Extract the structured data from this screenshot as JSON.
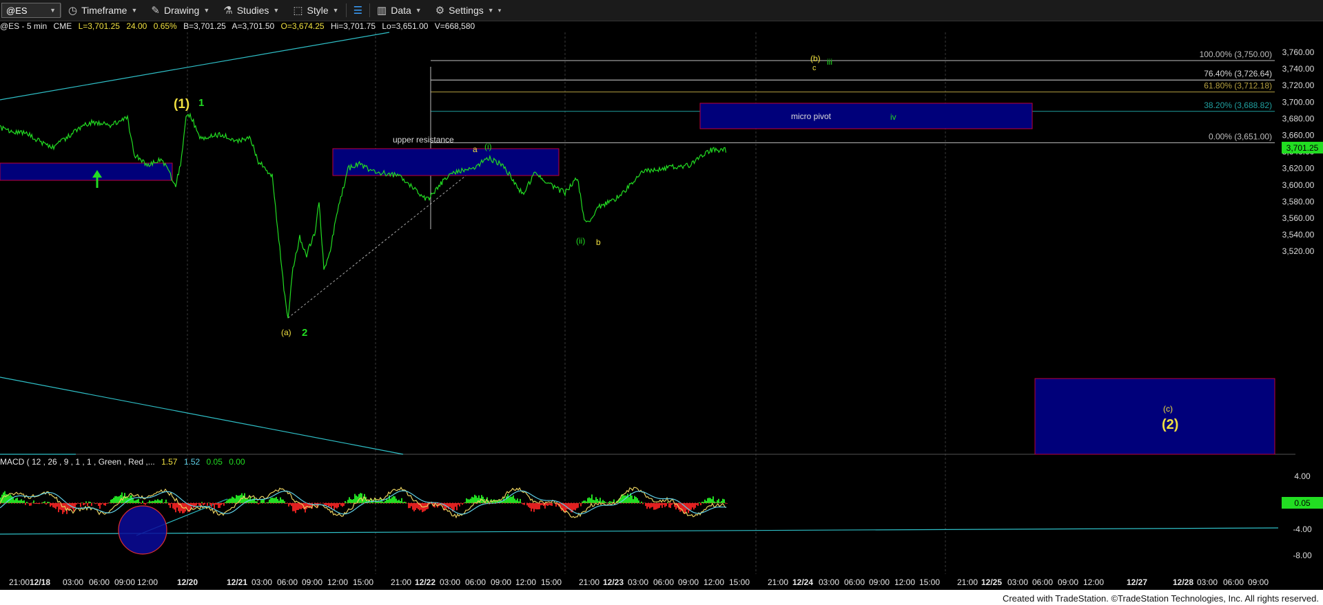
{
  "toolbar": {
    "symbol": "@ES",
    "timeframe": "Timeframe",
    "drawing": "Drawing",
    "studies": "Studies",
    "style": "Style",
    "data": "Data",
    "settings": "Settings"
  },
  "infobar": {
    "symbol": "@ES - 5 min",
    "exchange": "CME",
    "last": "L=3,701.25",
    "change": "24.00",
    "pct": "0.65%",
    "bid": "B=3,701.25",
    "ask": "A=3,701.50",
    "open": "O=3,674.25",
    "high": "Hi=3,701.75",
    "low": "Lo=3,651.00",
    "volume": "V=668,580"
  },
  "macd": {
    "label": "MACD ( 12 , 26 , 9 , 1 , 1 , Green , Red ,...",
    "v1": "1.57",
    "v2": "1.52",
    "v3": "0.05",
    "v4": "0.00",
    "axis": [
      "4.00",
      "-4.00",
      "-8.00"
    ],
    "current": "0.05"
  },
  "price_axis": {
    "ticks": [
      "3,760.00",
      "3,740.00",
      "3,720.00",
      "3,700.00",
      "3,680.00",
      "3,660.00",
      "3,640.00",
      "3,620.00",
      "3,600.00",
      "3,580.00",
      "3,560.00",
      "3,540.00",
      "3,520.00"
    ],
    "current": "3,701.25"
  },
  "fib_levels": [
    {
      "label": "100.00% (3,750.00)",
      "price": 3750.0,
      "color": "#bfbfbf"
    },
    {
      "label": "76.40% (3,726.64)",
      "price": 3726.64,
      "color": "#d8d8d8"
    },
    {
      "label": "61.80% (3,712.18)",
      "price": 3712.18,
      "color": "#b5a040"
    },
    {
      "label": "38.20% (3,688.82)",
      "price": 3688.82,
      "color": "#20a0a0"
    },
    {
      "label": "0.00% (3,651.00)",
      "price": 3651.0,
      "color": "#bfbfbf"
    }
  ],
  "annotations": {
    "upper_resistance": "upper resistance",
    "micro_pivot": "micro pivot",
    "wave_1_yellow": "(1)",
    "wave_1_green": "1",
    "wave_a": "(a)",
    "wave_2_green": "2",
    "small_a": "a",
    "wave_i": "(i)",
    "wave_ii": "(ii)",
    "small_b": "b",
    "wave_b_top": "(b)",
    "small_c": "c",
    "wave_iii": "iii",
    "wave_iv": "iv",
    "wave_c": "(c)",
    "wave_2_big": "(2)"
  },
  "time_axis": [
    "21:00",
    "12/18",
    "03:00",
    "06:00",
    "09:00",
    "12:00",
    "12/20",
    "12/21",
    "03:00",
    "06:00",
    "09:00",
    "12:00",
    "15:00",
    "21:00",
    "12/22",
    "03:00",
    "06:00",
    "09:00",
    "12:00",
    "15:00",
    "21:00",
    "12/23",
    "03:00",
    "06:00",
    "09:00",
    "12:00",
    "15:00",
    "21:00",
    "12/24",
    "03:00",
    "06:00",
    "09:00",
    "12:00",
    "15:00",
    "21:00",
    "12/25",
    "03:00",
    "06:00",
    "09:00",
    "12:00",
    "12/27",
    "12/28",
    "03:00",
    "06:00",
    "09:00"
  ],
  "footer": "Created with TradeStation. ©TradeStation Technologies, Inc. All rights reserved.",
  "colors": {
    "price": "#22dd22",
    "box": "#00007a",
    "box_border": "#c0003a",
    "trendline": "#2fc0c8"
  }
}
